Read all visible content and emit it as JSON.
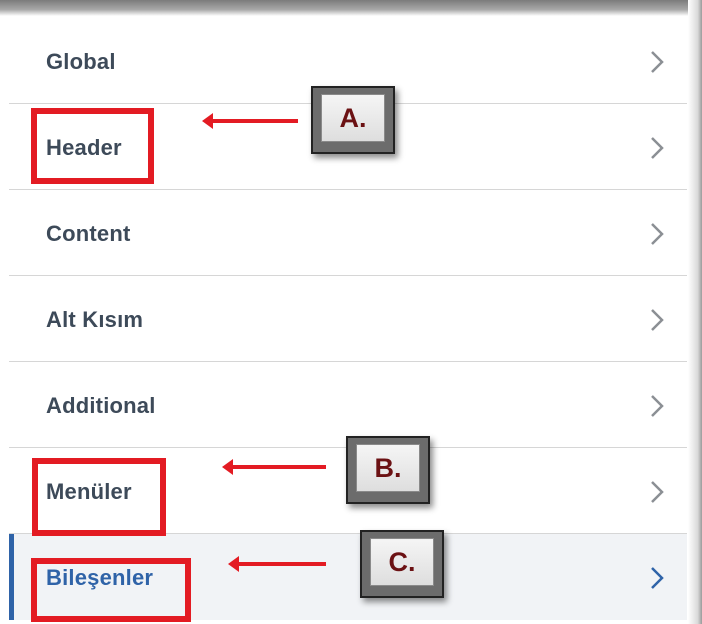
{
  "menu": {
    "items": [
      {
        "label": "Global",
        "active": false
      },
      {
        "label": "Header",
        "active": false
      },
      {
        "label": "Content",
        "active": false
      },
      {
        "label": "Alt Kısım",
        "active": false
      },
      {
        "label": "Additional",
        "active": false
      },
      {
        "label": "Menüler",
        "active": false
      },
      {
        "label": "Bileşenler",
        "active": true
      }
    ]
  },
  "annotations": {
    "a": {
      "label": "A.",
      "target": "Header"
    },
    "b": {
      "label": "B.",
      "target": "Menüler"
    },
    "c": {
      "label": "C.",
      "target": "Bileşenler"
    }
  },
  "colors": {
    "highlight": "#e31b23",
    "active_accent": "#2f63a8",
    "text": "#3d4a59"
  },
  "icons": {
    "chevron": "chevron-right-icon"
  }
}
